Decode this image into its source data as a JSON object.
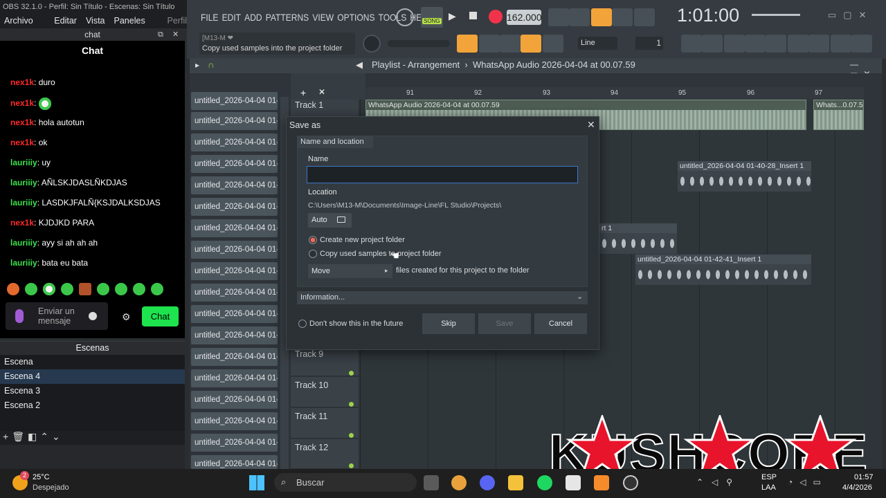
{
  "obs": {
    "title": "OBS 32.1.0 - Perfil: Sin Título - Escenas: Sin Título",
    "menu": [
      "Archivo (F)",
      "Editar",
      "Vista",
      "Paneles (D)",
      "Perfil"
    ],
    "chat_dock_title": "chat",
    "chat": {
      "title": "Chat",
      "messages": [
        {
          "user": "nex1k",
          "text": ": duro",
          "color": "#ff2a2a"
        },
        {
          "user": "nex1k",
          "text": ":",
          "color": "#ff2a2a"
        },
        {
          "user": "nex1k",
          "text": ": hola autotun",
          "color": "#ff2a2a"
        },
        {
          "user": "nex1k",
          "text": ": ok",
          "color": "#ff2a2a"
        },
        {
          "user": "lauriiiy",
          "text": ": uy",
          "color": "#3ee04f"
        },
        {
          "user": "lauriiiy",
          "text": ": AÑLSKJDASLÑKDJAS",
          "color": "#3ee04f"
        },
        {
          "user": "lauriiiy",
          "text": ": LASDKJFALÑ{KSJDALKSDJAS",
          "color": "#3ee04f"
        },
        {
          "user": "nex1k",
          "text": ": KJDJKD PARA",
          "color": "#ff2a2a"
        },
        {
          "user": "lauriiiy",
          "text": ": ayy si ah ah ah",
          "color": "#3ee04f"
        },
        {
          "user": "lauriiiy",
          "text": ": bata eu bata",
          "color": "#3ee04f"
        }
      ],
      "input_placeholder": "Enviar un mensaje",
      "send_label": "Chat"
    },
    "scenes": {
      "title": "Escenas",
      "items": [
        "Escena",
        "Escena 4",
        "Escena 3",
        "Escena 2"
      ],
      "selected": "Escena 4"
    }
  },
  "fl": {
    "menu": [
      "FILE",
      "EDIT",
      "ADD",
      "PATTERNS",
      "VIEW",
      "OPTIONS",
      "TOOLS",
      "HELP"
    ],
    "tempo": "162.000",
    "time": "1:01:00",
    "hint_title": "[M13-M ❤",
    "hint_text": "Copy used samples into the project folder",
    "snap": "Line",
    "step": "1",
    "song_label": "SONG",
    "playlist_title": "Playlist - Arrangement",
    "playlist_file": "WhatsApp Audio 2026-04-04 at 00.07.59",
    "pattern_label": "untitled_2026-04-04 01-...",
    "ruler_ticks": [
      "91",
      "92",
      "93",
      "94",
      "95",
      "96",
      "97"
    ],
    "tracks": [
      "Track 1",
      "Track 9",
      "Track 10",
      "Track 11",
      "Track 12"
    ],
    "clips": {
      "whatsapp": "WhatsApp Audio 2026-04-04 at 00.07.59",
      "whatsapp_short": "Whats...0.07.59",
      "insert1_a": "untitled_2026-04-04 01-40-28_Insert 1",
      "insert1_b": "rt 1",
      "insert1_c": "untitled_2026-04-04 01-42-41_Insert 1"
    }
  },
  "dialog": {
    "title": "Save as",
    "section": "Name and location",
    "name_label": "Name",
    "name_value": "",
    "location_label": "Location",
    "location_path": "C:\\Users\\M13-M\\Documents\\Image-Line\\FL Studio\\Projects\\",
    "auto_label": "Auto",
    "option_new_folder": "Create new project folder",
    "option_copy_samples": "Copy used samples to project folder",
    "move_select": "Move",
    "move_suffix": "files created for this project to the folder",
    "information": "Information...",
    "dont_show": "Don't show this in the future",
    "buttons": {
      "skip": "Skip",
      "save": "Save",
      "cancel": "Cancel"
    }
  },
  "taskbar": {
    "weather_temp": "25°C",
    "weather_desc": "Despejado",
    "weather_badge": "2",
    "search_placeholder": "Buscar",
    "lang_1": "ESP",
    "lang_2": "LAA",
    "time": "01:57",
    "date": "4/4/2026"
  },
  "watermark": "KUSHCORE",
  "colors": {
    "accent_green": "#1ee34f",
    "fl_orange": "#f2a33a",
    "selection_blue": "#26394f"
  }
}
